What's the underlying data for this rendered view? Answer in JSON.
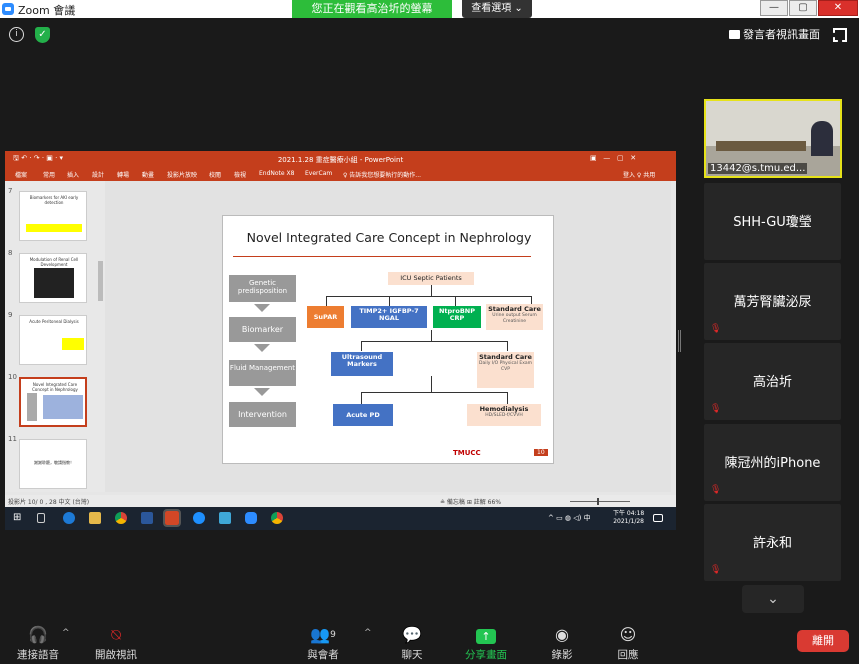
{
  "window": {
    "title": "Zoom 會議",
    "viewing": "您正在觀看高治圻的螢幕",
    "view_options": "查看選項 ⌄",
    "min": "—",
    "max": "▢",
    "close": "✕"
  },
  "top": {
    "share_label": "發言者視訊畫面"
  },
  "ppt": {
    "title": "2021.1.28 重症醫療小組 - PowerPoint",
    "tabs": [
      "檔案",
      "常用",
      "插入",
      "設計",
      "轉場",
      "動畫",
      "投影片放映",
      "校閱",
      "檢視",
      "EndNote X8",
      "EverCam",
      "♀ 告訴我您想要執行的動作..."
    ],
    "account": "登入  ♀ 共用",
    "thumbs": [
      {
        "num": "7",
        "title": "Biomarkers for AKI early detection"
      },
      {
        "num": "8",
        "title": "Modulation of Renal Cell Development"
      },
      {
        "num": "9",
        "title": "Acute Peritoneal Dialysis"
      },
      {
        "num": "10",
        "title": "Novel Integrated Care Concept in Nephrology"
      },
      {
        "num": "11",
        "title": "謝謝聆聽，敬請指教！"
      }
    ],
    "slide": {
      "title": "Novel Integrated Care Concept in Nephrology",
      "left": [
        "Genetic predisposition",
        "Biomarker",
        "Fluid Management",
        "Intervention"
      ],
      "icu": "ICU Septic Patients",
      "suPAR": "SuPAR",
      "timp": "TIMP2+ IGFBP-7 NGAL",
      "ntpro": "NtproBNP CRP",
      "std1": "Standard Care",
      "std1_sub": "Urine output Serum Creatinine",
      "ultra": "Ultrasound Markers",
      "std2": "Standard Care",
      "std2_sub": "Daily I/O Physical Exam CVP",
      "apd": "Acute PD",
      "hemo": "Hemodialysis",
      "hemo_sub": "HD/SLED-f/CVVH",
      "logo": "TMUCC",
      "page": "10"
    },
    "status_left": "投影片 10/ 0 , 28   中文 (台灣)",
    "status_right": "≗ 備忘稿   ⊞ 註解              66%",
    "time": "下午 04:18",
    "date": "2021/1/28"
  },
  "participants": {
    "active_label": "13442@s.tmu.ed...",
    "tiles": [
      "SHH-GU瓊瑩",
      "萬芳腎臟泌尿",
      "高治圻",
      "陳冠州的iPhone",
      "許永和"
    ]
  },
  "toolbar": {
    "audio": "連接語音",
    "video": "開啟視訊",
    "participants": "與會者",
    "participants_count": "9",
    "chat": "聊天",
    "share": "分享畫面",
    "record": "錄影",
    "reactions": "回應",
    "leave": "離開"
  }
}
